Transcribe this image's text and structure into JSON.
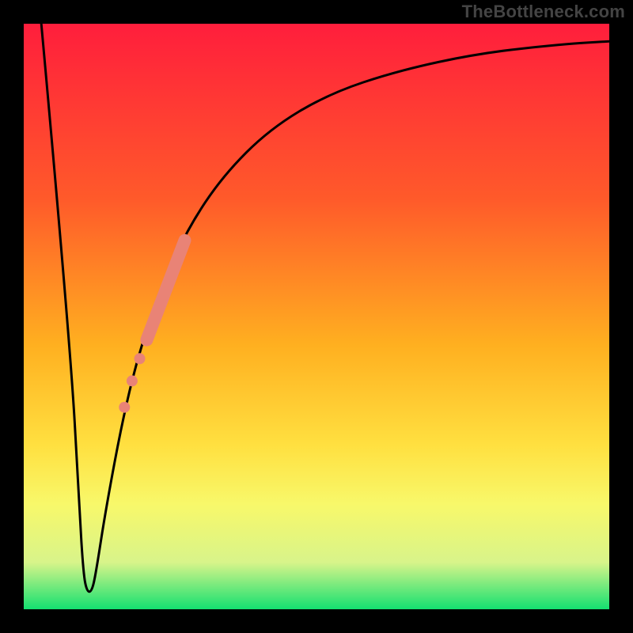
{
  "watermark": "TheBottleneck.com",
  "chart_data": {
    "type": "line",
    "title": "",
    "xlabel": "",
    "ylabel": "",
    "xlim": [
      0,
      100
    ],
    "ylim": [
      0,
      100
    ],
    "gradient_stops": [
      {
        "offset": 0,
        "color": "#ff1e3c"
      },
      {
        "offset": 0.3,
        "color": "#ff5a2a"
      },
      {
        "offset": 0.55,
        "color": "#ffb020"
      },
      {
        "offset": 0.72,
        "color": "#ffe040"
      },
      {
        "offset": 0.82,
        "color": "#f8f86a"
      },
      {
        "offset": 0.92,
        "color": "#d8f48a"
      },
      {
        "offset": 1.0,
        "color": "#14e070"
      }
    ],
    "series": [
      {
        "name": "curve",
        "points": [
          {
            "x": 3.0,
            "y": 100.0
          },
          {
            "x": 8.0,
            "y": 45.0
          },
          {
            "x": 9.5,
            "y": 17.0
          },
          {
            "x": 10.2,
            "y": 6.0
          },
          {
            "x": 10.8,
            "y": 3.0
          },
          {
            "x": 11.6,
            "y": 3.0
          },
          {
            "x": 12.3,
            "y": 6.0
          },
          {
            "x": 14.0,
            "y": 17.0
          },
          {
            "x": 17.0,
            "y": 33.0
          },
          {
            "x": 20.0,
            "y": 45.0
          },
          {
            "x": 24.0,
            "y": 56.0
          },
          {
            "x": 28.0,
            "y": 65.0
          },
          {
            "x": 34.0,
            "y": 74.0
          },
          {
            "x": 42.0,
            "y": 82.0
          },
          {
            "x": 52.0,
            "y": 88.0
          },
          {
            "x": 64.0,
            "y": 92.0
          },
          {
            "x": 78.0,
            "y": 95.0
          },
          {
            "x": 92.0,
            "y": 96.5
          },
          {
            "x": 100.0,
            "y": 97.0
          }
        ]
      }
    ],
    "highlights": {
      "thick_segment": {
        "x0": 21.0,
        "y0": 46.0,
        "x1": 27.5,
        "y1": 63.0
      },
      "dots": [
        {
          "x": 19.8,
          "y": 42.8
        },
        {
          "x": 18.5,
          "y": 39.0
        },
        {
          "x": 17.2,
          "y": 34.5
        }
      ],
      "color": "#e98376"
    }
  }
}
